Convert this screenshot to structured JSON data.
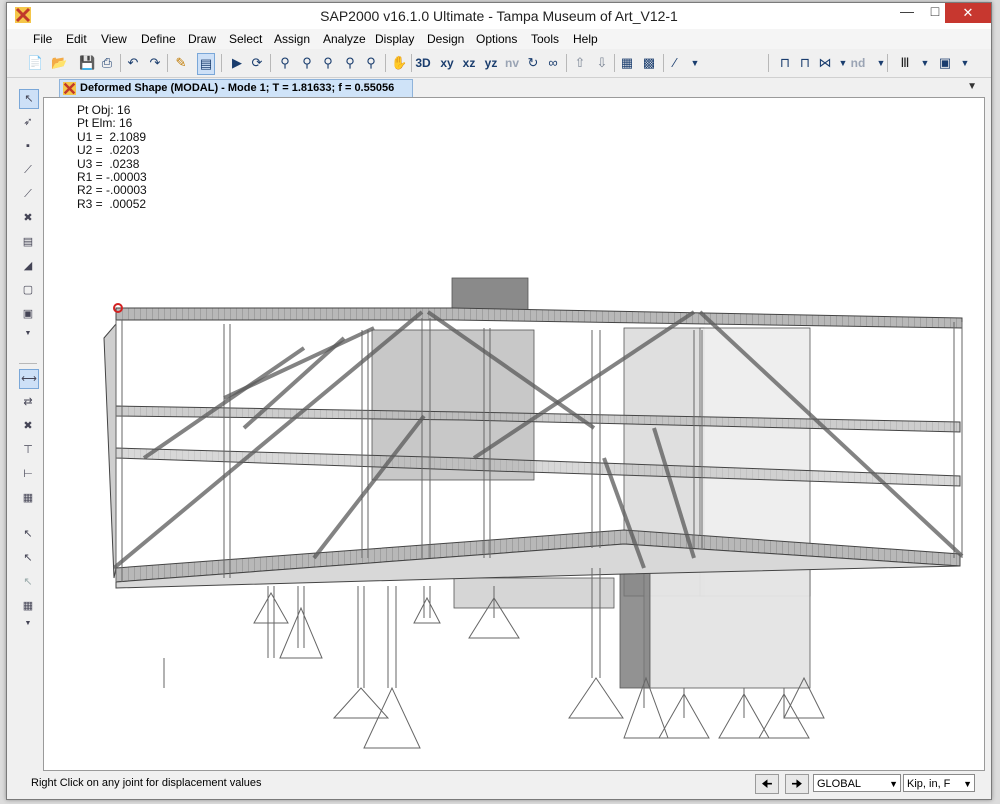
{
  "window": {
    "title": "SAP2000 v16.1.0 Ultimate  - Tampa Museum of Art_V12-1"
  },
  "menu": [
    "File",
    "Edit",
    "View",
    "Define",
    "Draw",
    "Select",
    "Assign",
    "Analyze",
    "Display",
    "Design",
    "Options",
    "Tools",
    "Help"
  ],
  "toolbar": {
    "view_labels": {
      "xy": "xy",
      "xz": "xz",
      "yz": "yz",
      "nv": "nv",
      "nd": "nd",
      "three_d": "3D"
    }
  },
  "tab": {
    "label": "Deformed Shape (MODAL) - Mode 1; T = 1.81633;  f = 0.55056"
  },
  "readout": [
    "Pt Obj: 16",
    "Pt Elm: 16",
    "U1 =  2.1089",
    "U2 =  .0203",
    "U3 =  .0238",
    "R1 = -.00003",
    "R2 = -.00003",
    "R3 =  .00052"
  ],
  "status": {
    "message": "Right Click on any joint for displacement values",
    "coord_system": "GLOBAL",
    "units": "Kip, in, F"
  },
  "colors": {
    "close_button": "#c7372f",
    "active_tab": "#cfe3f8",
    "selected_joint": "#d22222"
  }
}
